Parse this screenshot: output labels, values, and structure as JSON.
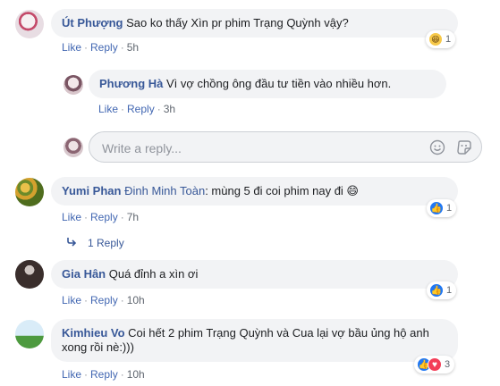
{
  "actions": {
    "like": "Like",
    "reply": "Reply",
    "separator": "·"
  },
  "composer": {
    "placeholder": "Write a reply..."
  },
  "comments": [
    {
      "name": "Út Phượng",
      "text": "Sao ko thấy Xìn pr phim Trạng Quỳnh vậy?",
      "time": "5h",
      "reaction": "haha",
      "count": "1"
    },
    {
      "name": "Phương Hà",
      "text": "Vì vợ chồng ông đầu tư tiền vào nhiều hơn.",
      "time": "3h"
    },
    {
      "name": "Yumi Phan",
      "tag": "Đinh Minh Toàn",
      "text": ": mùng 5 đi coi phim nay đi 😄",
      "time": "7h",
      "reaction": "like",
      "count": "1",
      "replies": "1 Reply"
    },
    {
      "name": "Gia Hân",
      "text": "Quá đỉnh a xìn ơi",
      "time": "10h",
      "reaction": "like",
      "count": "1"
    },
    {
      "name": "Kimhieu Vo",
      "text": "Coi hết 2 phim Trạng Quỳnh và Cua lại vợ bầu ủng hộ anh xong rồi nè:)))",
      "time": "10h",
      "reaction": "like+love",
      "count": "3"
    }
  ],
  "icons": {
    "emoji": "smiley-icon",
    "sticker": "sticker-icon",
    "like": "like-icon",
    "love": "love-icon",
    "haha": "haha-icon",
    "reply_arrow": "reply-arrow-icon"
  },
  "colors": {
    "link": "#385898",
    "bubble": "#f2f3f5",
    "like": "#2078f4",
    "love": "#f33e58",
    "haha": "#f7c94a"
  }
}
